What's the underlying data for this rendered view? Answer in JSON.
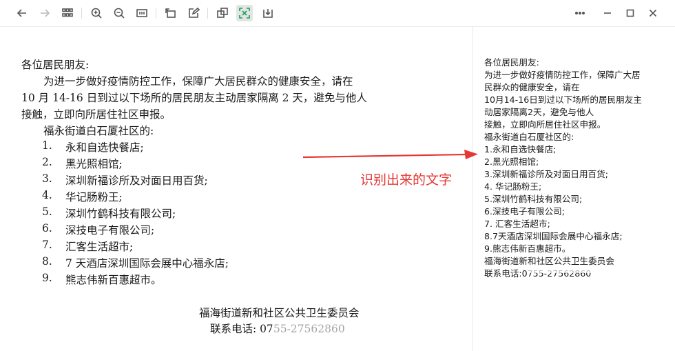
{
  "toolbar": {
    "icons": [
      "back-arrow-icon",
      "forward-arrow-icon",
      "grid-icon",
      "zoom-in-icon",
      "zoom-out-icon",
      "fit-page-icon",
      "rotate-icon",
      "edit-icon",
      "copy-icon",
      "ocr-icon",
      "download-icon",
      "more-icon",
      "minimize-icon",
      "maximize-icon",
      "close-icon"
    ]
  },
  "document": {
    "greeting": "各位居民朋友:",
    "para_line1": "为进一步做好疫情防控工作，保障广大居民群众的健康安全，请在",
    "para_line2": "10 月 14-16 日到过以下场所的居民朋友主动居家隔离 2 天，避免与他人",
    "para_line3": "接触，立即向所居住社区申报。",
    "sub_heading": "福永街道白石厦社区的:",
    "items": [
      {
        "num": "1.",
        "text": "永和自选快餐店;"
      },
      {
        "num": "2.",
        "text": "黑光照相馆;"
      },
      {
        "num": "3.",
        "text": "深圳新福诊所及对面日用百货;"
      },
      {
        "num": "4.",
        "text": "华记肠粉王;"
      },
      {
        "num": "5.",
        "text": "深圳竹鹤科技有限公司;"
      },
      {
        "num": "6.",
        "text": "深技电子有限公司;"
      },
      {
        "num": "7.",
        "text": "汇客生活超市;"
      },
      {
        "num": "8.",
        "text": "7 天酒店深圳国际会展中心福永店;"
      },
      {
        "num": "9.",
        "text": "熊志伟新百惠超市。"
      }
    ],
    "signature": "福海街道新和社区公共卫生委员会",
    "phone": "联系电话: 0755-27562860"
  },
  "annotation": {
    "label": "识别出来的文字",
    "color": "#e53935"
  },
  "ocr": {
    "lines": [
      "各位居民朋友:",
      "为进一步做好疫情防控工作，保障广大居",
      "民群众的健康安全，请在",
      "10月14-16日到过以下场所的居民朋友主",
      "动居家隔离2天，避免与他人",
      "接触，立即向所居住社区申报。",
      "福永街道白石厦社区的:",
      "1.永和自选快餐店;",
      "2.黑光照相馆;",
      "3.深圳新福诊所及对面日用百货;",
      "4. 华记肠粉王;",
      "5.深圳竹鹤科技有限公司;",
      "6.深技电子有限公司;",
      "7. 汇客生活超市;",
      "8.7天酒店深圳国际会展中心福永店;",
      "9.熊志伟新百惠超市。",
      "福海街道新和社区公共卫生委员会",
      "联系电话:0755-27562860"
    ]
  }
}
